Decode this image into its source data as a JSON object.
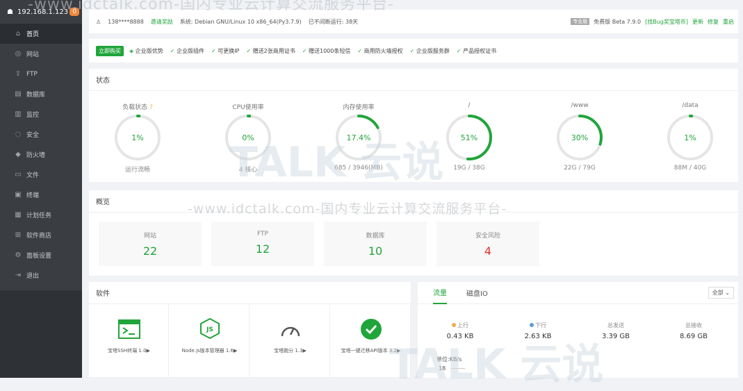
{
  "sidebar": {
    "ip": "192.168.1.123",
    "badge": "0",
    "items": [
      {
        "label": "首页",
        "icon": "⌂"
      },
      {
        "label": "网站",
        "icon": "◎"
      },
      {
        "label": "FTP",
        "icon": "⇪"
      },
      {
        "label": "数据库",
        "icon": "▤"
      },
      {
        "label": "监控",
        "icon": "▥"
      },
      {
        "label": "安全",
        "icon": "◌"
      },
      {
        "label": "防火墙",
        "icon": "◆"
      },
      {
        "label": "文件",
        "icon": "▭"
      },
      {
        "label": "终端",
        "icon": "▣"
      },
      {
        "label": "计划任务",
        "icon": "▦"
      },
      {
        "label": "软件商店",
        "icon": "⊞"
      },
      {
        "label": "面板设置",
        "icon": "⚙"
      },
      {
        "label": "退出",
        "icon": "⇥"
      }
    ]
  },
  "topbar": {
    "user": "138****8888",
    "invite": "邀请奖励",
    "system": "系统:  Debian GNU/Linux 10 x86_64(Py3.7.9)",
    "uptime": "已不间断运行: 38天",
    "pro_tag": "专业版",
    "version": "免费版  Beta 7.9.0",
    "bug_reward": "[找Bug奖宝塔币]",
    "update": "更新",
    "repair": "修复",
    "restart": "重启"
  },
  "promo": {
    "buy": "立即购买",
    "items": [
      "企业版优势",
      "企业版插件",
      "可更换IP",
      "赠送2张商用证书",
      "赠送1000条短信",
      "商用防火墙授权",
      "企业版服务群",
      "产品授权证书"
    ]
  },
  "status": {
    "title": "状态",
    "gauges": [
      {
        "label": "负载状态",
        "value": "1%",
        "sub": "运行流畅",
        "pct": 0.01
      },
      {
        "label": "CPU使用率",
        "value": "0%",
        "sub": "4 核心",
        "pct": 0.0
      },
      {
        "label": "内存使用率",
        "value": "17.4%",
        "sub": "685 / 3946(MB)",
        "pct": 0.174
      },
      {
        "label": "/",
        "value": "51%",
        "sub": "19G / 38G",
        "pct": 0.51
      },
      {
        "label": "/www",
        "value": "30%",
        "sub": "22G / 79G",
        "pct": 0.3
      },
      {
        "label": "/data",
        "value": "1%",
        "sub": "88M / 40G",
        "pct": 0.01
      }
    ]
  },
  "overview": {
    "title": "概览",
    "boxes": [
      {
        "label": "网站",
        "value": "22"
      },
      {
        "label": "FTP",
        "value": "12"
      },
      {
        "label": "数据库",
        "value": "10"
      },
      {
        "label": "安全风险",
        "value": "4"
      }
    ]
  },
  "software": {
    "title": "软件",
    "items": [
      {
        "name": "宝塔SSH终端 1.0▶"
      },
      {
        "name": "Node.js版本管理器 1.6▶"
      },
      {
        "name": "宝塔跑分 1.3▶"
      },
      {
        "name": "宝塔一键迁移API版本 3.2▶"
      }
    ]
  },
  "flow": {
    "tabs": [
      "流量",
      "磁盘IO"
    ],
    "select": "全部",
    "stats": [
      {
        "label": "上行",
        "value": "0.43 KB",
        "dot": "#f0ad4e"
      },
      {
        "label": "下行",
        "value": "2.63 KB",
        "dot": "#5b9bd5"
      },
      {
        "label": "总发送",
        "value": "3.39 GB",
        "dot": ""
      },
      {
        "label": "总接收",
        "value": "8.69 GB",
        "dot": ""
      }
    ],
    "unit": "单位:KB/s",
    "y_tick": "18"
  },
  "watermark": {
    "top": "-www.idctalk.com-国内专业云计算交流服务平台-",
    "mid": "-www.idctalk.com-国内专业云计算交流服务平台-",
    "logo": "TALK 云说"
  },
  "colors": {
    "accent": "#20a53a",
    "danger": "#e23030",
    "sidebar": "#3a3d42"
  }
}
